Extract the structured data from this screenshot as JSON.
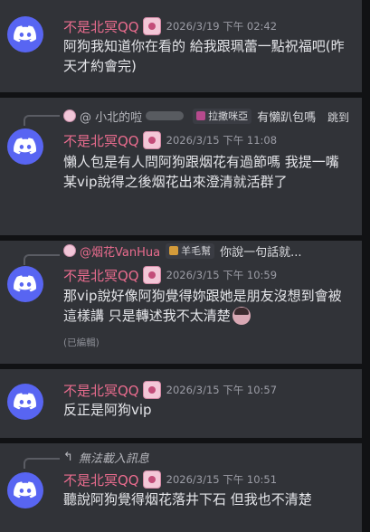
{
  "messages": [
    {
      "username": "不是北冥QQ",
      "timestamp": "2026/3/19 下午 02:42",
      "text": "阿狗我知道你在看的 給我跟珮蕾一點祝福吧(昨天才約會完)"
    },
    {
      "reply": {
        "name": "@ 小北的啦",
        "tag": "拉撒咪亞",
        "preview": "有懶趴包嗎",
        "jump": "跳到"
      },
      "username": "不是北冥QQ",
      "timestamp": "2026/3/15 下午 11:08",
      "text": "懶人包是有人問阿狗跟烟花有過節嗎 我提一嘴某vip說得之後烟花出來澄清就活群了"
    },
    {
      "reply": {
        "name": "@烟花VanHua",
        "tag": "羊毛幫",
        "preview": "你說一句話就..."
      },
      "username": "不是北冥QQ",
      "timestamp": "2026/3/15 下午 10:59",
      "text": "那vip說好像阿狗覺得妳跟她是朋友沒想到會被這樣講 只是轉述我不太清楚",
      "edited": "(已編輯)"
    },
    {
      "username": "不是北冥QQ",
      "timestamp": "2026/3/15 下午 10:57",
      "text": "反正是阿狗vip"
    },
    {
      "reply": {
        "preview": "無法載入訊息"
      },
      "username": "不是北冥QQ",
      "timestamp": "2026/3/15 下午 10:51",
      "text": "聽說阿狗覺得烟花落井下石 但我也不清楚"
    }
  ],
  "colors": {
    "accent": "#5865f2",
    "username": "#e96c8e",
    "panel": "#313338"
  }
}
